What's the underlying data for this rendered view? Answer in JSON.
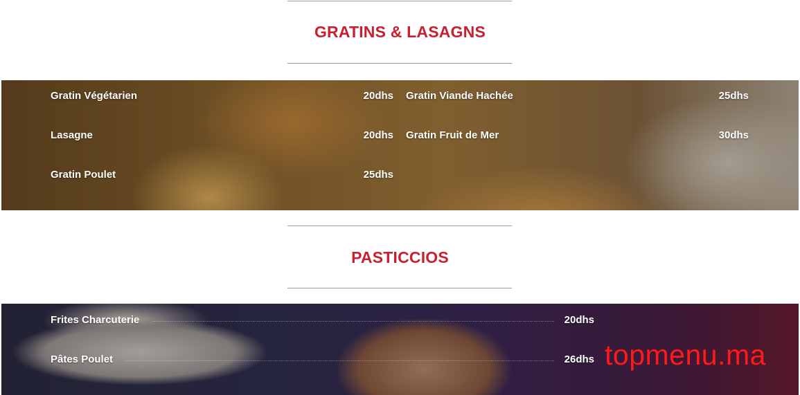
{
  "sections": [
    {
      "title": "GRATINS & LASAGNS",
      "items": [
        {
          "name": "Gratin Végétarien",
          "price": "20dhs"
        },
        {
          "name": "Gratin Viande Hachée",
          "price": "25dhs"
        },
        {
          "name": "Lasagne",
          "price": "20dhs"
        },
        {
          "name": "Gratin Fruit de Mer",
          "price": "30dhs"
        },
        {
          "name": "Gratin Poulet",
          "price": "25dhs"
        }
      ]
    },
    {
      "title": "PASTICCIOS",
      "items": [
        {
          "name": "Frites Charcuterie",
          "price": "20dhs"
        },
        {
          "name": "Pâtes Poulet",
          "price": "26dhs"
        }
      ]
    }
  ],
  "watermark": "topmenu.ma",
  "colors": {
    "title": "#c8202f",
    "watermark": "#ff1a1a",
    "rule": "#9a9a9a"
  }
}
